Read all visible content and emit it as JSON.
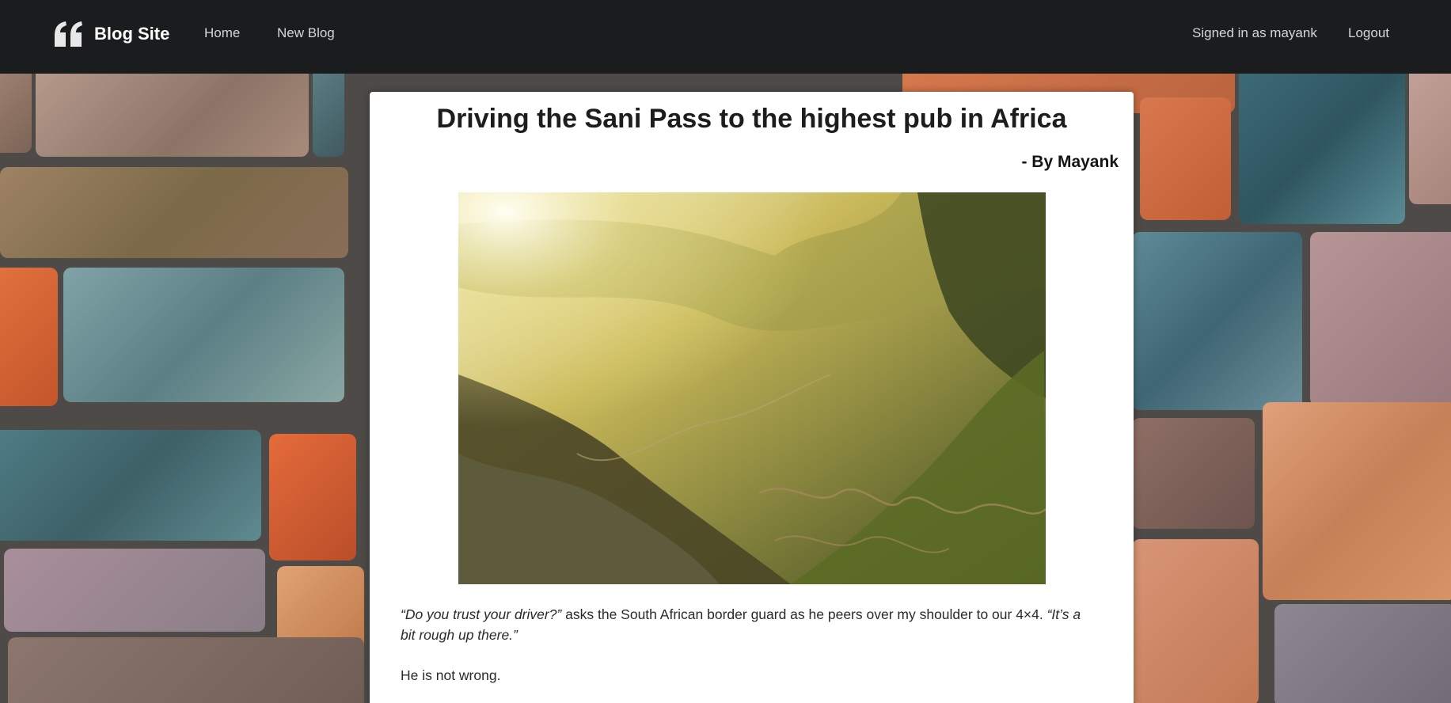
{
  "navbar": {
    "brand_icon": "quote-icon",
    "brand_name": "Blog Site",
    "links": [
      {
        "label": "Home"
      },
      {
        "label": "New Blog"
      }
    ],
    "signed_in_text": "Signed in as mayank",
    "logout_label": "Logout"
  },
  "post": {
    "title": "Driving the Sani Pass to the highest pub in Africa",
    "author": "- By Mayank",
    "image_icon": "mountain-pass-image",
    "paragraphs": {
      "p1_quote1": "“Do you trust your driver?”",
      "p1_text": " asks the South African border guard as he peers over my shoulder to our 4×4. ",
      "p1_quote2": "“It’s a bit rough up there.”",
      "p2_text": "He is not wrong."
    }
  },
  "colors": {
    "navbar_bg": "#1b1c1e",
    "nav_text": "#d7d7d7",
    "card_bg": "#ffffff",
    "title_color": "#1d1d1f"
  }
}
